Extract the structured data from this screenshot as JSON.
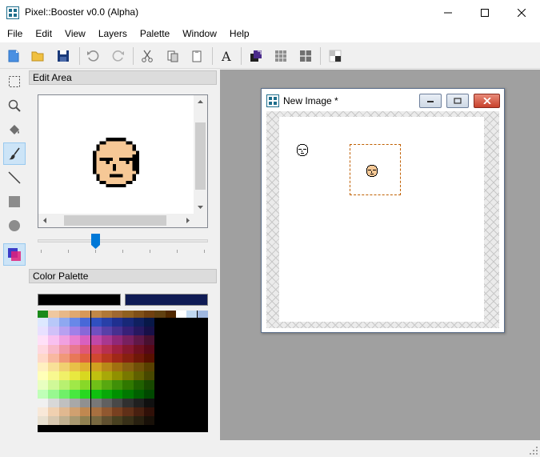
{
  "window": {
    "title": "Pixel::Booster v0.0 (Alpha)",
    "icons": [
      "app-icon",
      "minimize-icon",
      "maximize-icon",
      "close-icon"
    ]
  },
  "menu": [
    "File",
    "Edit",
    "View",
    "Layers",
    "Palette",
    "Window",
    "Help"
  ],
  "toolbar": {
    "buttons": [
      "new-file-icon",
      "open-folder-icon",
      "save-icon",
      "undo-icon",
      "redo-icon",
      "cut-icon",
      "copy-icon",
      "paste-icon",
      "text-icon",
      "swap-colors-icon",
      "grid-icon",
      "tile-grid-icon",
      "transparency-icon"
    ]
  },
  "tools": [
    "rect-select-icon",
    "zoom-icon",
    "fill-bucket-icon",
    "brush-icon",
    "line-icon",
    "rectangle-icon",
    "ellipse-icon",
    "color-icon"
  ],
  "active_tool": "brush-icon",
  "edit_area": {
    "header": "Edit Area",
    "zoom_slider_value": 0.34
  },
  "color_palette": {
    "header": "Color Palette",
    "foreground": "#000000",
    "background": "#0f1b54",
    "top_row": [
      "#1a8a1a",
      "#f0c8a0",
      "#e8b888",
      "#e0a870",
      "#d89858",
      "#c08848",
      "#b07838",
      "#a06830",
      "#906020",
      "#805018",
      "#704010",
      "#604010",
      "#502800",
      "#ffffff",
      "#c0d8f0",
      "#a0b8e0"
    ],
    "rows": [
      [
        "#dde8ff",
        "#b8c8f8",
        "#8ea8f0",
        "#6888e8",
        "#4868d8",
        "#3050c0",
        "#2840a8",
        "#203090",
        "#182878",
        "#102060",
        "#081848"
      ],
      [
        "#e8e0ff",
        "#d0c0f8",
        "#b8a0f0",
        "#a080e8",
        "#8868d8",
        "#7050c0",
        "#5840a8",
        "#483090",
        "#382078",
        "#281860",
        "#181048"
      ],
      [
        "#ffe0f8",
        "#f8c0f0",
        "#f0a0e0",
        "#e880d0",
        "#d860c0",
        "#c048a8",
        "#a83890",
        "#902878",
        "#782060",
        "#601848",
        "#481030"
      ],
      [
        "#ffd8e0",
        "#f8b8c8",
        "#f098a8",
        "#e87890",
        "#e05878",
        "#d04060",
        "#b83050",
        "#a02040",
        "#881830",
        "#701020",
        "#580818"
      ],
      [
        "#ffd8c8",
        "#f8b8a0",
        "#f09878",
        "#e87858",
        "#e06040",
        "#d04830",
        "#b83820",
        "#a02818",
        "#882010",
        "#701808",
        "#581000"
      ],
      [
        "#fff0c0",
        "#f8e098",
        "#f0d070",
        "#e8c048",
        "#e0b030",
        "#d0a020",
        "#b88818",
        "#a07010",
        "#886010",
        "#705008",
        "#584000"
      ],
      [
        "#ffffb8",
        "#f8f890",
        "#f0f068",
        "#e8e840",
        "#d8d820",
        "#c0c010",
        "#a8a808",
        "#909000",
        "#787800",
        "#606000",
        "#484800"
      ],
      [
        "#e8ffc0",
        "#d0f898",
        "#b8f070",
        "#a0e848",
        "#88d828",
        "#70c018",
        "#58a810",
        "#409008",
        "#307800",
        "#206000",
        "#184800"
      ],
      [
        "#c0ffb8",
        "#98f890",
        "#70f068",
        "#48e840",
        "#28d820",
        "#10c010",
        "#08a808",
        "#009000",
        "#007800",
        "#006000",
        "#004800"
      ],
      [
        "#f0f0f0",
        "#d8d8d8",
        "#c0c0c0",
        "#a8a8a8",
        "#909090",
        "#787878",
        "#606060",
        "#484848",
        "#303030",
        "#202020",
        "#101010"
      ],
      [
        "#f8e8d8",
        "#f0d0b0",
        "#e0b890",
        "#d0a070",
        "#c08850",
        "#a87040",
        "#905830",
        "#784020",
        "#603018",
        "#482010",
        "#301008"
      ],
      [
        "#e8e0d0",
        "#d8c8b0",
        "#c0b090",
        "#a89870",
        "#908050",
        "#786840",
        "#605030",
        "#484020",
        "#383018",
        "#282010",
        "#181008"
      ]
    ]
  },
  "child_window": {
    "title": "New Image *",
    "icons": [
      "app-icon",
      "minimize-icon",
      "restore-icon",
      "close-icon"
    ]
  }
}
